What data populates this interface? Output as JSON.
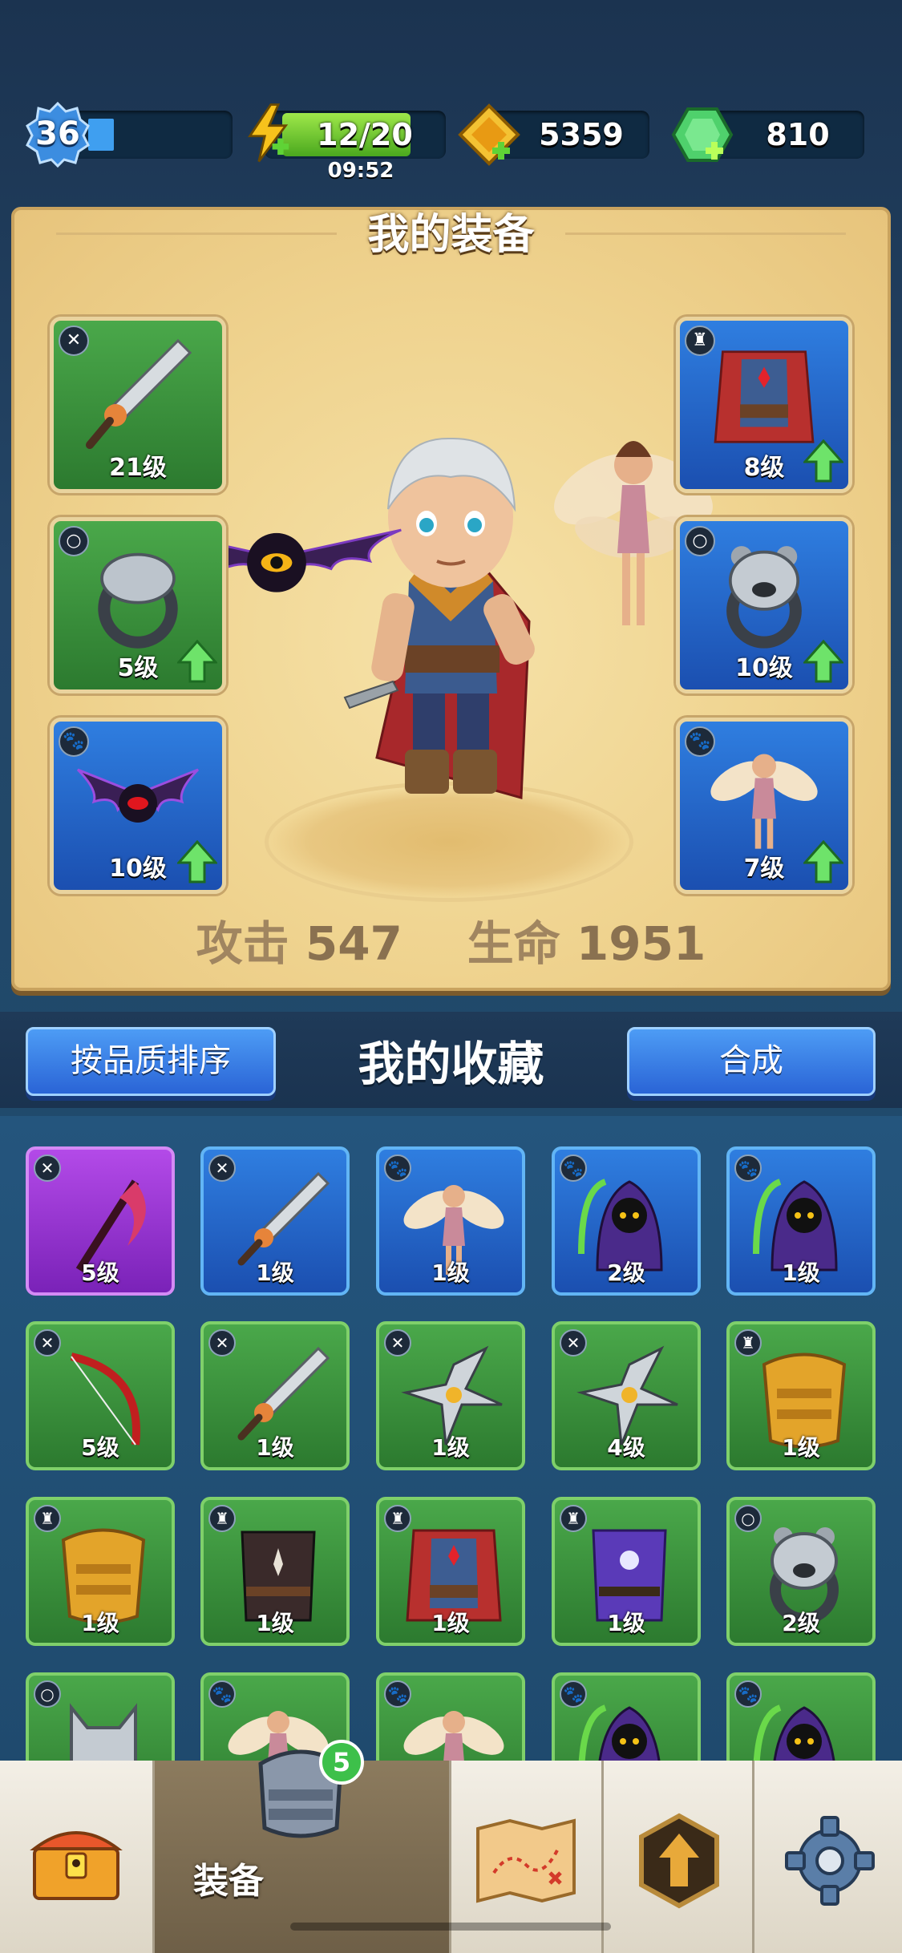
{
  "top_bar": {
    "level": "36",
    "energy": "12/20",
    "energy_timer": "09:52",
    "gold": "5359",
    "gems": "810"
  },
  "equipment_panel": {
    "title": "我的装备",
    "slots_left": [
      {
        "name": "sword",
        "level_text": "21级",
        "rarity": "green",
        "upgrade": false,
        "type_icon": "weapon-icon"
      },
      {
        "name": "ring",
        "level_text": "5级",
        "rarity": "green",
        "upgrade": true,
        "type_icon": "ring-icon"
      },
      {
        "name": "bat-pet",
        "level_text": "10级",
        "rarity": "blue",
        "upgrade": true,
        "type_icon": "paw-icon"
      }
    ],
    "slots_right": [
      {
        "name": "cape-armor",
        "level_text": "8级",
        "rarity": "blue",
        "upgrade": true,
        "type_icon": "armor-icon"
      },
      {
        "name": "bear-ring",
        "level_text": "10级",
        "rarity": "blue",
        "upgrade": true,
        "type_icon": "ring-icon"
      },
      {
        "name": "fairy-pet",
        "level_text": "7级",
        "rarity": "blue",
        "upgrade": true,
        "type_icon": "paw-icon"
      }
    ],
    "stats": {
      "attack_label": "攻击",
      "attack_value": "547",
      "hp_label": "生命",
      "hp_value": "1951"
    }
  },
  "collection": {
    "title": "我的收藏",
    "sort_button": "按品质排序",
    "merge_button": "合成",
    "rows": [
      [
        {
          "item": "scythe",
          "rarity": "purple",
          "level_text": "5级",
          "type_icon": "weapon-icon"
        },
        {
          "item": "sword",
          "rarity": "blue",
          "level_text": "1级",
          "type_icon": "weapon-icon"
        },
        {
          "item": "fairy",
          "rarity": "blue",
          "level_text": "1级",
          "type_icon": "paw-icon"
        },
        {
          "item": "reaper",
          "rarity": "blue",
          "level_text": "2级",
          "type_icon": "paw-icon"
        },
        {
          "item": "reaper",
          "rarity": "blue",
          "level_text": "1级",
          "type_icon": "paw-icon"
        }
      ],
      [
        {
          "item": "bow",
          "rarity": "green",
          "level_text": "5级",
          "type_icon": "weapon-icon"
        },
        {
          "item": "sword",
          "rarity": "green",
          "level_text": "1级",
          "type_icon": "weapon-icon"
        },
        {
          "item": "shuriken",
          "rarity": "green",
          "level_text": "1级",
          "type_icon": "weapon-icon"
        },
        {
          "item": "shuriken",
          "rarity": "green",
          "level_text": "4级",
          "type_icon": "weapon-icon"
        },
        {
          "item": "gold-armor",
          "rarity": "green",
          "level_text": "1级",
          "type_icon": "armor-icon"
        }
      ],
      [
        {
          "item": "gold-armor",
          "rarity": "green",
          "level_text": "1级",
          "type_icon": "armor-icon"
        },
        {
          "item": "dark-vest",
          "rarity": "green",
          "level_text": "1级",
          "type_icon": "armor-icon"
        },
        {
          "item": "cape-armor",
          "rarity": "green",
          "level_text": "1级",
          "type_icon": "armor-icon"
        },
        {
          "item": "purple-robe",
          "rarity": "green",
          "level_text": "1级",
          "type_icon": "armor-icon"
        },
        {
          "item": "bear-ring",
          "rarity": "green",
          "level_text": "2级",
          "type_icon": "ring-icon"
        }
      ],
      [
        {
          "item": "wolf-ring",
          "rarity": "green",
          "level_text": "",
          "type_icon": "ring-icon"
        },
        {
          "item": "fairy",
          "rarity": "green",
          "level_text": "",
          "type_icon": "paw-icon"
        },
        {
          "item": "fairy",
          "rarity": "green",
          "level_text": "",
          "type_icon": "paw-icon"
        },
        {
          "item": "reaper",
          "rarity": "green",
          "level_text": "",
          "type_icon": "paw-icon"
        },
        {
          "item": "reaper",
          "rarity": "green",
          "level_text": "",
          "type_icon": "paw-icon"
        }
      ]
    ]
  },
  "bottom_nav": {
    "tabs": [
      {
        "id": "chest",
        "icon": "treasure-chest-icon"
      },
      {
        "id": "equipment",
        "icon": "armor-icon",
        "label": "装备",
        "badge": "5"
      },
      {
        "id": "map",
        "icon": "map-icon"
      },
      {
        "id": "upgrade",
        "icon": "upgrade-arrow-icon"
      },
      {
        "id": "settings",
        "icon": "gear-icon"
      }
    ]
  },
  "colors": {
    "rarity_green": "#3a953c",
    "rarity_blue": "#2565cc",
    "rarity_purple": "#9a36d4",
    "panel_parchment": "#f1d899",
    "button_blue": "#3a7fe6"
  }
}
